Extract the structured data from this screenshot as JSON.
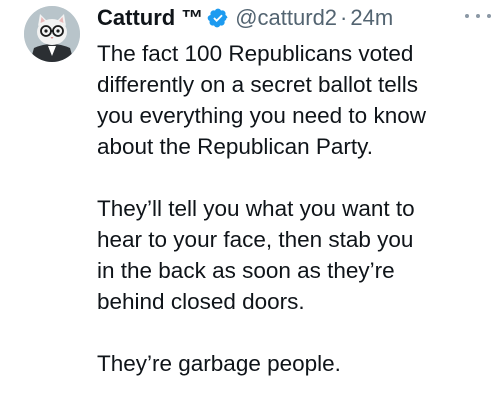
{
  "tweet": {
    "author": {
      "display_name": "Catturd",
      "tm": "™",
      "handle": "@catturd2",
      "separator": "·",
      "time": "24m",
      "verified": true
    },
    "paragraphs": [
      {
        "lines": [
          "The fact 100 Republicans voted",
          "differently on a secret ballot tells",
          "you everything you need to know",
          "about the Republican Party."
        ]
      },
      {
        "lines": [
          "They’ll tell you what you want to",
          "hear to your face, then stab you",
          "in the back as soon as they’re",
          "behind closed doors."
        ]
      },
      {
        "lines": [
          "They’re garbage people."
        ]
      }
    ]
  },
  "colors": {
    "text": "#0f1419",
    "secondary": "#536471",
    "verified": "#1d9bf0"
  },
  "icons": {
    "verified": "verified-badge-icon",
    "more": "more-options-icon",
    "avatar": "cat-avatar"
  }
}
